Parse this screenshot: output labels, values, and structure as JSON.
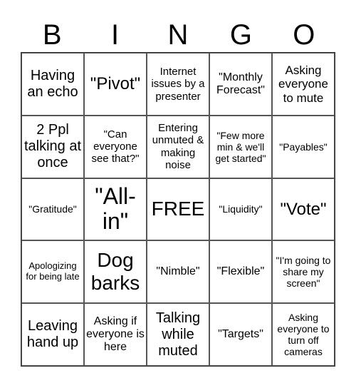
{
  "header": [
    "B",
    "I",
    "N",
    "G",
    "O"
  ],
  "cells": [
    {
      "text": "Having an echo",
      "size": "s20"
    },
    {
      "text": "\"Pivot\"",
      "size": "s24"
    },
    {
      "text": "Internet issues by a presenter",
      "size": "s15"
    },
    {
      "text": "\"Monthly Forecast\"",
      "size": "s16"
    },
    {
      "text": "Asking everyone to mute",
      "size": "s17"
    },
    {
      "text": "2 Ppl talking at once",
      "size": "s20"
    },
    {
      "text": "\"Can everyone see that?\"",
      "size": "s15"
    },
    {
      "text": "Entering unmuted & making noise",
      "size": "s15"
    },
    {
      "text": "\"Few more min & we'll get started\"",
      "size": "s14"
    },
    {
      "text": "\"Payables\"",
      "size": "s14"
    },
    {
      "text": "\"Gratitude\"",
      "size": "s14"
    },
    {
      "text": "\"All-in\"",
      "size": "s32"
    },
    {
      "text": "FREE",
      "size": "s28"
    },
    {
      "text": "\"Liquidity\"",
      "size": "s14"
    },
    {
      "text": "\"Vote\"",
      "size": "s24"
    },
    {
      "text": "Apologizing for being late",
      "size": "s12"
    },
    {
      "text": "Dog barks",
      "size": "s28"
    },
    {
      "text": "\"Nimble\"",
      "size": "s16"
    },
    {
      "text": "\"Flexible\"",
      "size": "s16"
    },
    {
      "text": "\"I'm going to share my screen\"",
      "size": "s14"
    },
    {
      "text": "Leaving hand up",
      "size": "s20"
    },
    {
      "text": "Asking if everyone is here",
      "size": "s16"
    },
    {
      "text": "Talking while muted",
      "size": "s20"
    },
    {
      "text": "\"Targets\"",
      "size": "s16"
    },
    {
      "text": "Asking everyone to turn off cameras",
      "size": "s14"
    }
  ]
}
